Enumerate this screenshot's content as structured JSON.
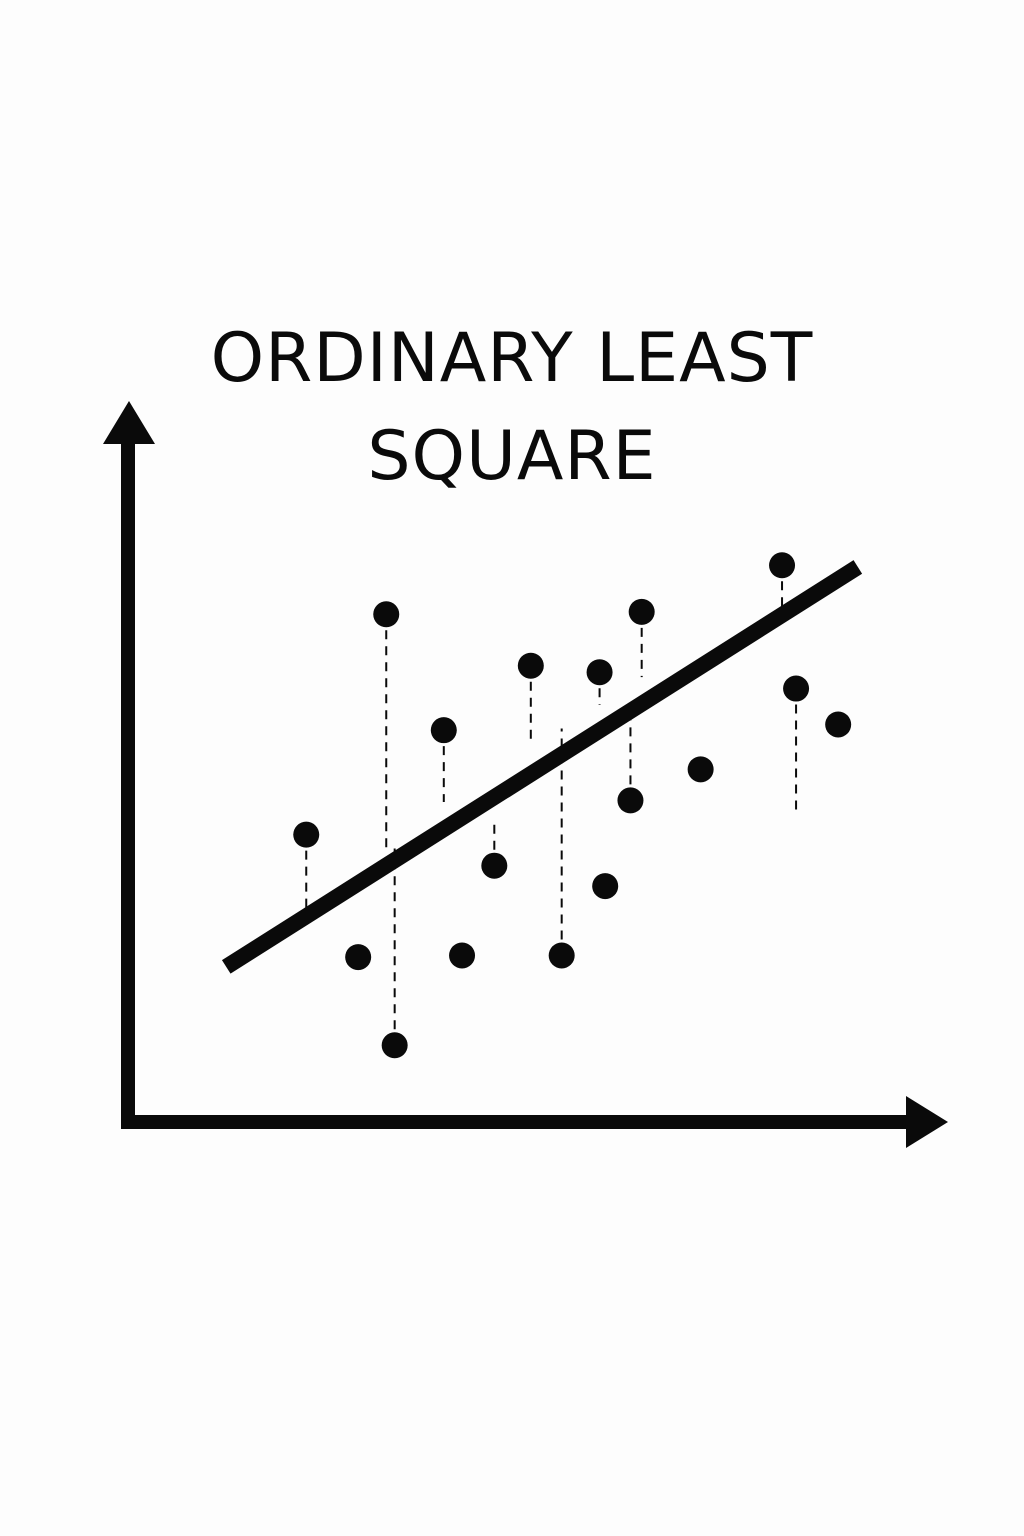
{
  "title": {
    "line1": "ORDINARY LEAST",
    "line2": "SQUARE"
  },
  "colors": {
    "ink": "#0a0a0a",
    "background": "#fdfdfd"
  },
  "chart_data": {
    "type": "scatter",
    "points": [
      {
        "x": 1.07,
        "y": 3.42,
        "fit": 2.44
      },
      {
        "x": 1.44,
        "y": 1.92
      },
      {
        "x": 1.64,
        "y": 6.12,
        "fit": 3.21
      },
      {
        "x": 1.7,
        "y": 0.84,
        "fit": 3.25
      },
      {
        "x": 2.05,
        "y": 4.7,
        "fit": 3.82
      },
      {
        "x": 2.18,
        "y": 1.94
      },
      {
        "x": 2.41,
        "y": 3.04,
        "fit": 3.58
      },
      {
        "x": 2.67,
        "y": 5.49,
        "fit": 4.58
      },
      {
        "x": 2.89,
        "y": 1.94,
        "fit": 4.72
      },
      {
        "x": 3.16,
        "y": 5.41,
        "fit": 5.01
      },
      {
        "x": 3.2,
        "y": 2.79
      },
      {
        "x": 3.38,
        "y": 3.84,
        "fit": 5.02
      },
      {
        "x": 3.46,
        "y": 6.15,
        "fit": 5.35
      },
      {
        "x": 3.88,
        "y": 4.22
      },
      {
        "x": 4.46,
        "y": 6.72,
        "fit": 6.19
      },
      {
        "x": 4.56,
        "y": 5.21,
        "fit": 3.68
      },
      {
        "x": 4.86,
        "y": 4.77
      }
    ],
    "line": {
      "x": [
        0.5,
        5.0
      ],
      "y": [
        1.8,
        6.7
      ]
    },
    "xlim": [
      -0.2,
      5.5
    ],
    "ylim": [
      -0.1,
      8.5
    ],
    "grid": false
  }
}
